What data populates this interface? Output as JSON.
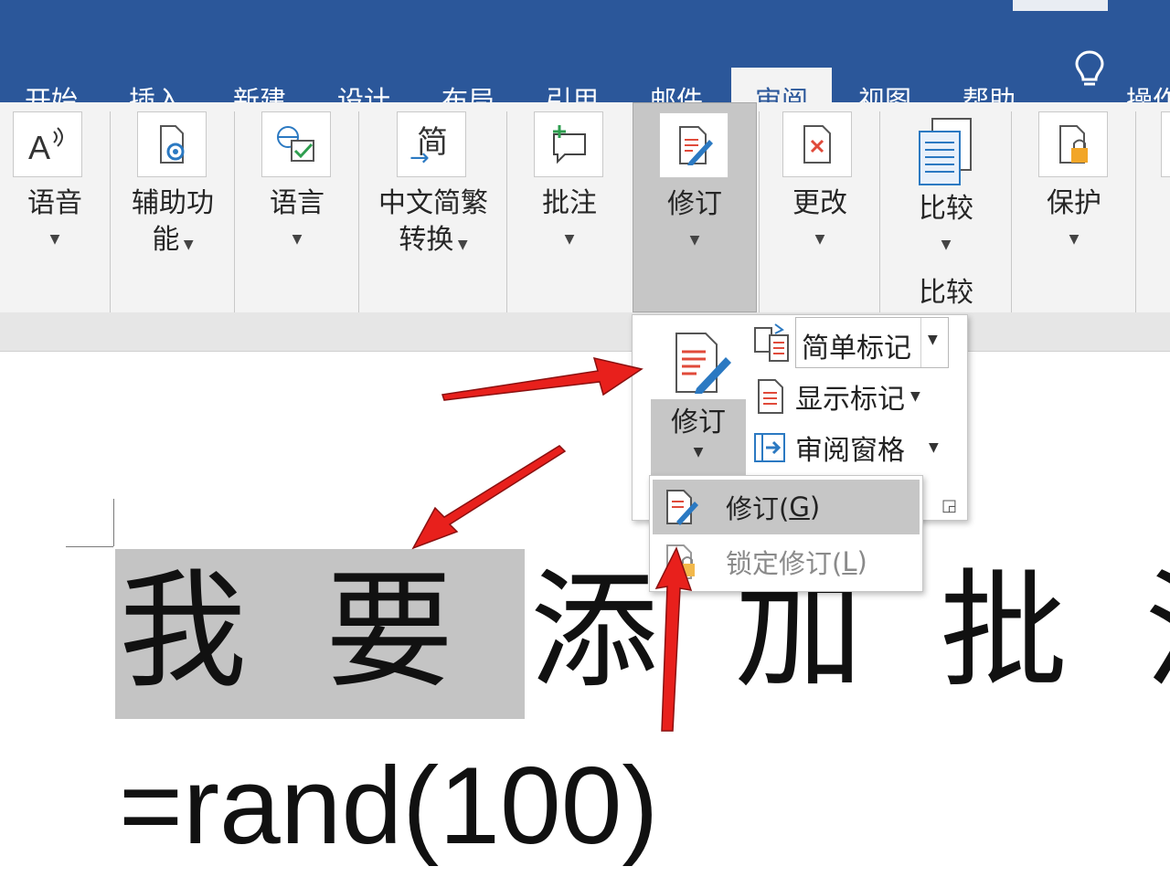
{
  "tabs": [
    {
      "label": "开始"
    },
    {
      "label": "插入"
    },
    {
      "label": "新建"
    },
    {
      "label": "设计"
    },
    {
      "label": "布局"
    },
    {
      "label": "引用"
    },
    {
      "label": "邮件"
    },
    {
      "label": "审阅",
      "active": true
    },
    {
      "label": "视图"
    },
    {
      "label": "帮助"
    }
  ],
  "tell_me": {
    "label": "操作",
    "icon": "lightbulb-icon"
  },
  "ribbon": {
    "speech": {
      "label": "语音",
      "icon": "read-aloud-icon"
    },
    "accessibility": {
      "label1": "辅助功",
      "label2": "能",
      "icon": "accessibility-icon"
    },
    "language": {
      "label": "语言",
      "icon": "language-icon"
    },
    "chinese_conversion": {
      "label1": "中文简繁",
      "label2": "转换",
      "icon_text": "简",
      "icon": "simplified-traditional-icon"
    },
    "comments": {
      "label": "批注",
      "icon": "new-comment-icon"
    },
    "tracking": {
      "label": "修订",
      "icon": "track-changes-icon"
    },
    "changes": {
      "label": "更改",
      "icon": "reject-change-icon"
    },
    "compare": {
      "label": "比较",
      "group_label": "比较",
      "icon": "compare-icon"
    },
    "protect": {
      "label": "保护",
      "icon": "protect-icon"
    }
  },
  "panel": {
    "track_changes_label": "修订",
    "markup_select_value": "简单标记",
    "show_markup_label": "显示标记",
    "reviewing_pane_label": "审阅窗格"
  },
  "submenu": {
    "item1": {
      "text": "修订(",
      "key": "G",
      "close": ")"
    },
    "item2": {
      "text": "锁定修订(",
      "key": "L",
      "close": ")"
    }
  },
  "document": {
    "line1_chars": [
      "我",
      "要",
      "添",
      "加",
      "批",
      "注"
    ],
    "line2": "=rand(100)"
  },
  "colors": {
    "brand": "#2b579a",
    "arrow": "#e8201c"
  }
}
